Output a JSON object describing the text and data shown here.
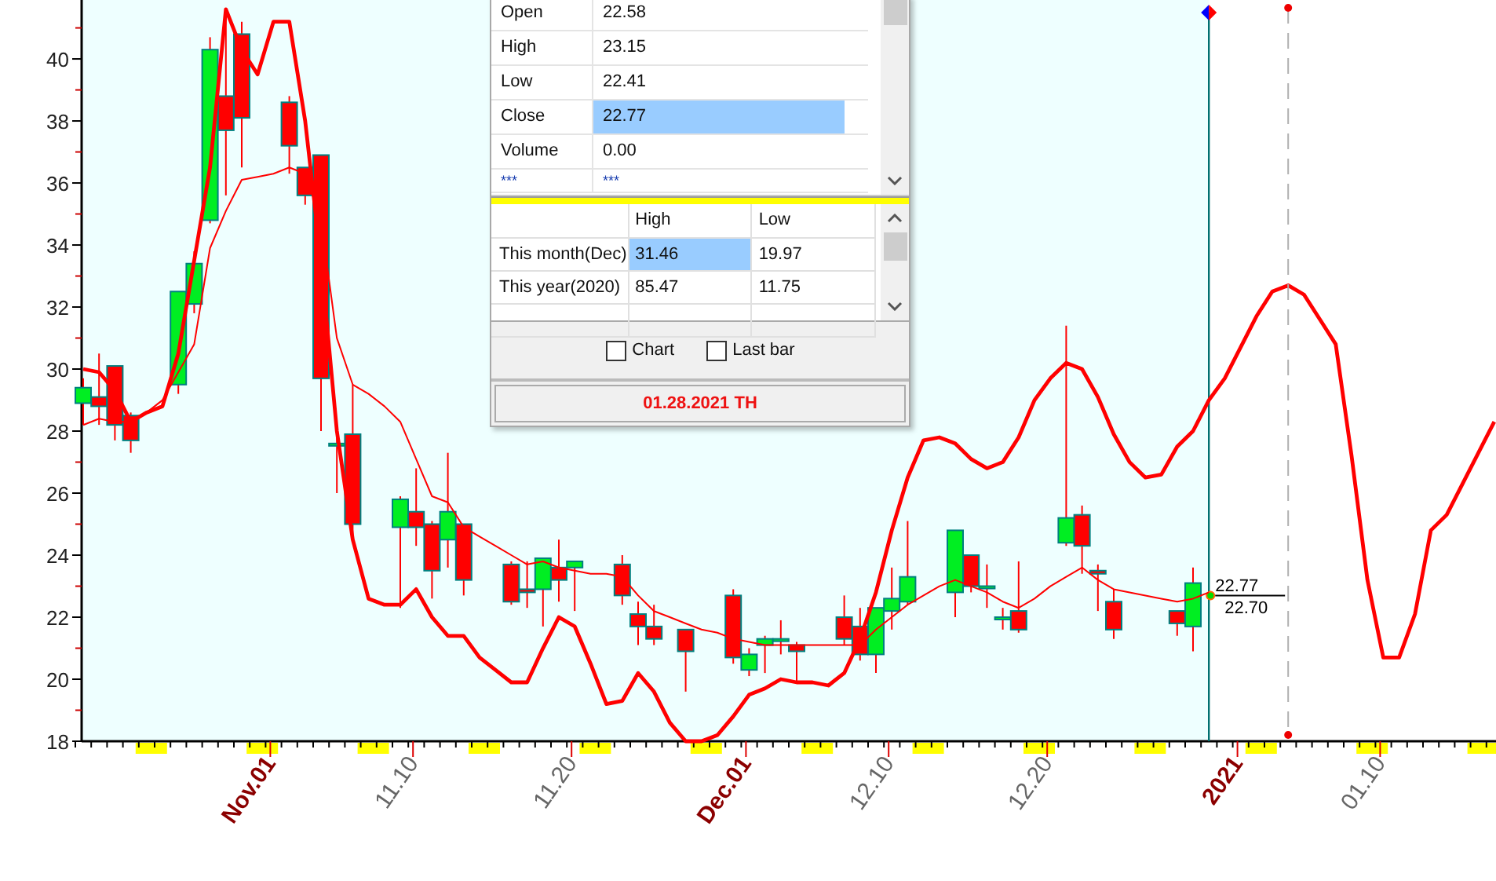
{
  "chart": {
    "label_emphasis": [
      true,
      false,
      false,
      true,
      false,
      false,
      true,
      false
    ],
    "chart_data": {
      "type": "candlestick",
      "ylim": [
        18,
        41.9
      ],
      "categories": [
        null,
        null,
        null,
        null,
        null,
        null,
        null,
        null,
        null,
        null,
        null,
        null,
        "Nov.01",
        null,
        null,
        null,
        null,
        null,
        null,
        null,
        null,
        "11.10",
        null,
        null,
        null,
        null,
        null,
        null,
        null,
        null,
        null,
        "11.20",
        null,
        null,
        null,
        null,
        null,
        null,
        null,
        null,
        null,
        null,
        "Dec.01",
        null,
        null,
        null,
        null,
        null,
        null,
        null,
        null,
        "12.10",
        null,
        null,
        null,
        null,
        null,
        null,
        null,
        null,
        null,
        "12.20",
        null,
        null,
        null,
        null,
        null,
        null,
        null,
        null,
        null,
        null,
        null,
        "2021",
        null,
        null,
        null,
        null,
        null,
        null,
        null,
        null,
        "01.10",
        null,
        null,
        null,
        null,
        null,
        null,
        null
      ],
      "yticks": [
        18,
        20,
        22,
        24,
        26,
        28,
        30,
        32,
        34,
        36,
        38,
        40
      ],
      "ohlc": [
        [
          28.9,
          29.7,
          28.2,
          29.4
        ],
        [
          29.1,
          30.5,
          28.2,
          28.8
        ],
        [
          30.1,
          30.1,
          27.7,
          28.2
        ],
        [
          28.5,
          28.6,
          27.3,
          27.7
        ],
        null,
        null,
        [
          29.5,
          32.5,
          29.2,
          32.5
        ],
        [
          32.1,
          33.8,
          31.8,
          33.4
        ],
        [
          34.8,
          40.7,
          34.7,
          40.3
        ],
        [
          38.8,
          41.3,
          35.6,
          37.7
        ],
        [
          40.8,
          41.2,
          36.5,
          38.1
        ],
        null,
        null,
        [
          38.6,
          38.8,
          36.3,
          37.2
        ],
        [
          36.5,
          36.5,
          35.3,
          35.6
        ],
        [
          36.9,
          36.9,
          28.0,
          29.7
        ],
        [
          27.6,
          28.2,
          26.0,
          27.6
        ],
        [
          27.9,
          29.5,
          24.6,
          25.0
        ],
        null,
        null,
        [
          24.9,
          25.9,
          22.3,
          25.8
        ],
        [
          25.4,
          26.8,
          24.3,
          24.9
        ],
        [
          25.0,
          25.1,
          22.6,
          23.5
        ],
        [
          24.5,
          27.3,
          23.6,
          25.4
        ],
        [
          25.0,
          25.0,
          22.7,
          23.2
        ],
        null,
        null,
        [
          23.7,
          23.8,
          22.4,
          22.5
        ],
        [
          22.9,
          23.8,
          22.3,
          22.8
        ],
        [
          22.9,
          23.9,
          21.7,
          23.9
        ],
        [
          23.6,
          24.5,
          22.5,
          23.2
        ],
        [
          23.6,
          23.8,
          22.2,
          23.8
        ],
        null,
        null,
        [
          23.7,
          24.0,
          22.4,
          22.7
        ],
        [
          22.1,
          22.5,
          21.1,
          21.7
        ],
        [
          21.7,
          22.4,
          21.1,
          21.3
        ],
        null,
        [
          21.6,
          21.6,
          19.6,
          20.9
        ],
        null,
        null,
        [
          22.7,
          22.9,
          20.5,
          20.7
        ],
        [
          20.3,
          21.0,
          20.1,
          20.8
        ],
        [
          21.1,
          21.4,
          20.2,
          21.3
        ],
        [
          21.3,
          21.9,
          20.8,
          21.3
        ],
        [
          21.1,
          21.2,
          19.9,
          20.9
        ],
        null,
        null,
        [
          22.0,
          22.7,
          21.1,
          21.3
        ],
        [
          21.7,
          22.3,
          20.6,
          20.8
        ],
        [
          20.8,
          22.3,
          20.2,
          22.3
        ],
        [
          22.2,
          23.6,
          21.6,
          22.6
        ],
        [
          22.5,
          25.1,
          22.4,
          23.3
        ],
        null,
        null,
        [
          22.8,
          24.8,
          22.0,
          24.8
        ],
        [
          24.0,
          24.0,
          22.8,
          23.0
        ],
        [
          23.0,
          23.7,
          22.3,
          23.0
        ],
        [
          22.0,
          22.3,
          21.6,
          22.0
        ],
        [
          22.2,
          23.8,
          21.5,
          21.6
        ],
        null,
        null,
        [
          24.4,
          31.4,
          24.3,
          25.2
        ],
        [
          25.3,
          25.6,
          23.4,
          24.3
        ],
        [
          23.5,
          23.7,
          22.2,
          23.4
        ],
        [
          22.5,
          22.9,
          21.3,
          21.6
        ],
        null,
        null,
        null,
        [
          22.2,
          22.2,
          21.4,
          21.8
        ],
        [
          21.7,
          23.6,
          20.9,
          23.1
        ],
        null,
        null,
        null,
        null,
        null,
        null,
        null,
        null,
        null,
        null,
        null,
        null,
        null,
        null,
        null,
        null,
        null,
        null,
        null
      ],
      "series": [
        {
          "type": "line",
          "color": "#ff0000",
          "values": [
            30.0,
            29.9,
            29.3,
            28.3,
            28.6,
            28.8,
            30.5,
            33.5,
            36.5,
            41.6,
            40.3,
            39.5,
            41.2,
            41.2,
            38.0,
            33.5,
            28.0,
            24.5,
            22.6,
            22.4,
            22.4,
            22.9,
            22.0,
            21.4,
            21.4,
            20.7,
            20.3,
            19.9,
            19.9,
            21.0,
            22.0,
            21.7,
            20.5,
            19.2,
            19.3,
            20.2,
            19.6,
            18.6,
            18.0,
            18.0,
            18.2,
            18.8,
            19.5,
            19.7,
            20.0,
            19.9,
            19.9,
            19.8,
            20.2,
            21.3,
            22.8,
            24.8,
            26.5,
            27.7,
            27.8,
            27.6,
            27.1,
            26.8,
            27.0,
            27.8,
            29.0,
            29.7,
            30.2,
            30.0,
            29.1,
            27.9,
            27.0,
            26.5,
            26.6,
            27.5,
            28.0,
            29.0,
            29.7,
            30.7,
            31.7,
            32.5,
            32.7,
            32.4,
            31.6,
            30.8,
            27.2,
            23.2,
            20.7,
            20.7,
            22.1,
            24.8,
            25.3,
            26.3,
            27.3,
            28.3
          ]
        },
        {
          "type": "line",
          "color": "#ff0000",
          "values": [
            28.2,
            28.4,
            28.3,
            28.3,
            28.6,
            29.0,
            29.9,
            30.8,
            33.9,
            35.1,
            36.1,
            36.2,
            36.3,
            36.5,
            36.3,
            34.8,
            31.0,
            29.5,
            29.2,
            28.8,
            28.3,
            27.1,
            25.9,
            25.7,
            24.9,
            24.6,
            24.3,
            24.0,
            23.7,
            23.8,
            23.6,
            23.5,
            23.4,
            23.4,
            23.3,
            22.7,
            22.2,
            22.0,
            21.8,
            21.6,
            21.5,
            21.3,
            21.2,
            21.1,
            21.1,
            21.1,
            21.1,
            21.1,
            21.1,
            21.1,
            21.6,
            22.0,
            22.4,
            22.7,
            23.0,
            23.2,
            23.0,
            22.8,
            22.5,
            22.3,
            22.6,
            23.0,
            23.3,
            23.6,
            23.2,
            22.9,
            22.8,
            22.7,
            22.6,
            22.5,
            22.6,
            22.8,
            null,
            null,
            null,
            null,
            null,
            null,
            null,
            null,
            null,
            null,
            null,
            null,
            null,
            null,
            null,
            null,
            null,
            null
          ]
        }
      ],
      "annotations": [
        "22.77",
        "22.70"
      ]
    }
  },
  "info_panel": {
    "quote_rows": [
      {
        "label": "Open",
        "value": "22.58",
        "selected": false
      },
      {
        "label": "High",
        "value": "23.15",
        "selected": false
      },
      {
        "label": "Low",
        "value": "22.41",
        "selected": false
      },
      {
        "label": "Close",
        "value": "22.77",
        "selected": true
      },
      {
        "label": "Volume",
        "value": "0.00",
        "selected": false
      },
      {
        "label": "***",
        "value": "***",
        "selected": false
      }
    ],
    "range_table": {
      "columns": [
        "High",
        "Low"
      ],
      "rows": [
        {
          "label": "This month(Dec)",
          "cells": [
            {
              "text": "31.46",
              "selected": true
            },
            {
              "text": "19.97",
              "selected": false
            }
          ]
        },
        {
          "label": "This year(2020)",
          "cells": [
            {
              "text": "85.47",
              "selected": false
            },
            {
              "text": "11.75",
              "selected": false
            }
          ]
        }
      ]
    },
    "checkboxes": [
      {
        "label": "Chart",
        "checked": false
      },
      {
        "label": "Last bar",
        "checked": false
      }
    ],
    "date": "01.28.2021 TH"
  }
}
